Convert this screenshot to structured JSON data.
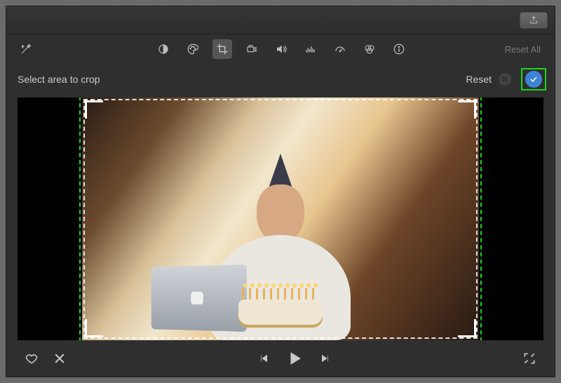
{
  "titlebar": {
    "share_icon": "share-icon"
  },
  "toolbar": {
    "wand_icon": "magic-wand-icon",
    "contrast_icon": "contrast-icon",
    "palette_icon": "color-palette-icon",
    "crop_icon": "crop-icon",
    "camera_icon": "camera-stabilization-icon",
    "volume_icon": "volume-icon",
    "eq_icon": "audio-equalizer-icon",
    "speed_icon": "speedometer-icon",
    "filters_icon": "color-filters-icon",
    "info_icon": "info-icon",
    "reset_all_label": "Reset All"
  },
  "crop": {
    "instruction": "Select area to crop",
    "reset_label": "Reset",
    "cancel_glyph": "✕",
    "apply_icon": "checkmark-icon"
  },
  "transport": {
    "favorite_icon": "heart-icon",
    "reject_icon": "reject-icon",
    "prev_icon": "previous-frame-icon",
    "play_icon": "play-icon",
    "next_icon": "next-frame-icon",
    "fullscreen_icon": "fullscreen-icon"
  },
  "colors": {
    "highlight": "#18d818",
    "apply": "#3d84d6"
  }
}
